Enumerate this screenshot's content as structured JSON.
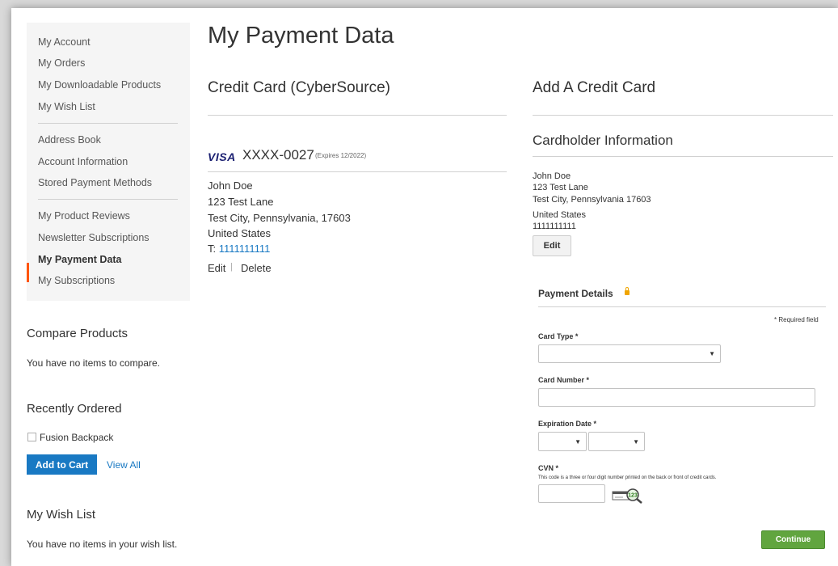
{
  "sidebar": {
    "nav_group1": [
      "My Account",
      "My Orders",
      "My Downloadable Products",
      "My Wish List"
    ],
    "nav_group2": [
      "Address Book",
      "Account Information",
      "Stored Payment Methods"
    ],
    "nav_group3": [
      "My Product Reviews",
      "Newsletter Subscriptions",
      "My Payment Data",
      "My Subscriptions"
    ],
    "current_item": "My Payment Data",
    "accent_color": "#ff5501",
    "compare": {
      "title": "Compare Products",
      "empty_text": "You have no items to compare."
    },
    "recently_ordered": {
      "title": "Recently Ordered",
      "item": "Fusion Backpack",
      "add_to_cart": "Add to Cart",
      "view_all": "View All"
    },
    "wishlist": {
      "title": "My Wish List",
      "empty_text": "You have no items in your wish list."
    }
  },
  "main": {
    "page_title": "My Payment Data",
    "stored_card": {
      "section_title": "Credit Card (CyberSource)",
      "brand": "VISA",
      "number": "XXXX-0027",
      "expires": "(Expires 12/2022)",
      "name": "John Doe",
      "street": "123 Test Lane",
      "city_line": "Test City, Pennsylvania, 17603",
      "country": "United States",
      "phone_prefix": "T: ",
      "phone": "1111111111",
      "edit": "Edit",
      "separator": "|",
      "delete": "Delete"
    },
    "add_card": {
      "section_title": "Add A Credit Card",
      "cardholder_title": "Cardholder Information",
      "name": "John Doe",
      "street": "123 Test Lane",
      "city_line": "Test City, Pennsylvania 17603",
      "country": "United States",
      "phone": "1111111111",
      "edit": "Edit"
    },
    "payment_details": {
      "title": "Payment Details",
      "required_note": "* Required field",
      "card_type_label": "Card Type *",
      "card_number_label": "Card Number *",
      "expiration_label": "Expiration Date *",
      "cvn_label": "CVN *",
      "cvn_note": "This code is a three or four digit number printed on the back or front of credit cards.",
      "cvn_icon_text": "123",
      "continue": "Continue",
      "button_color": "#61a53f"
    }
  }
}
